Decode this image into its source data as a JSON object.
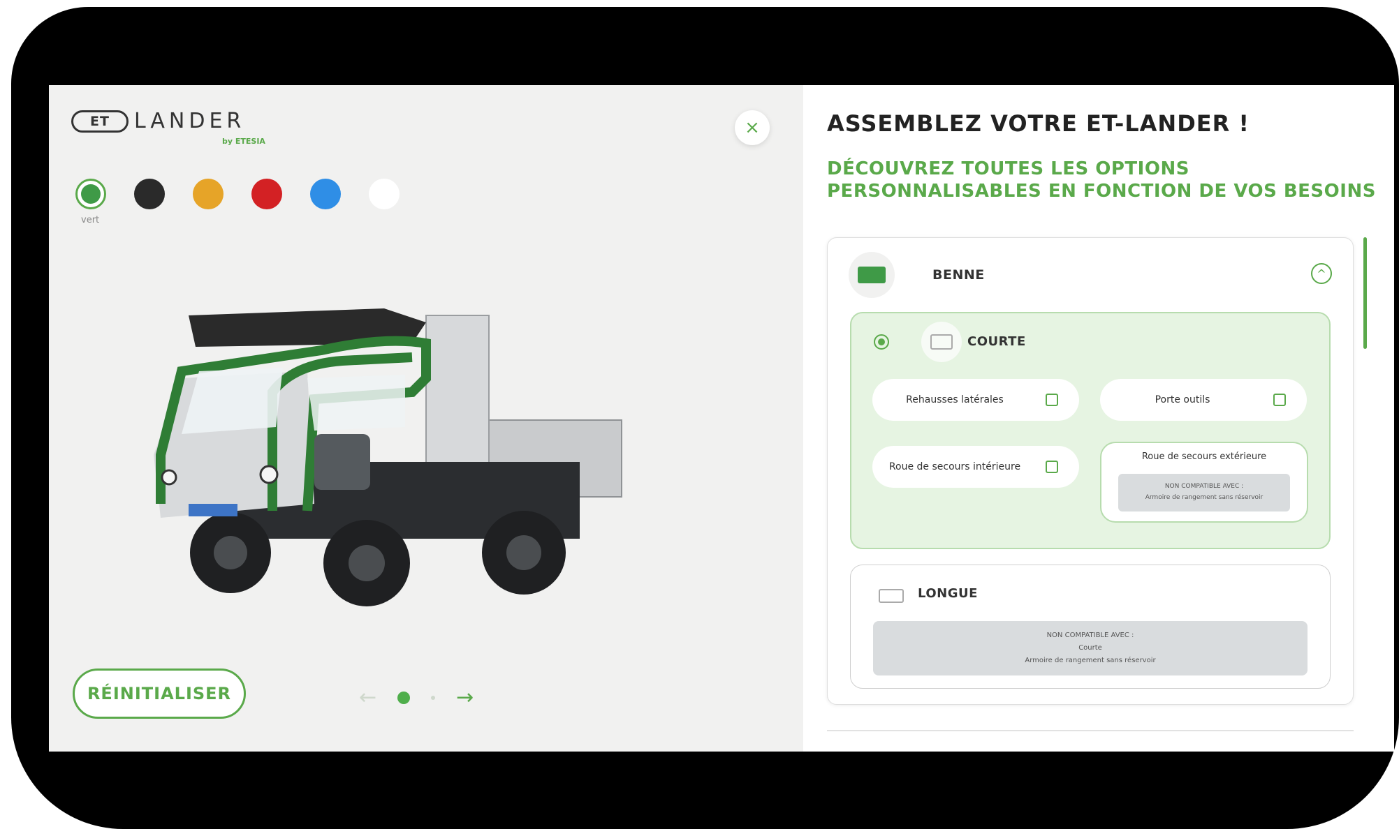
{
  "brand": {
    "badge": "ET",
    "name": "LANDER",
    "by_line": "by ETESIA"
  },
  "colors": {
    "selected_label": "vert",
    "swatches": [
      {
        "name": "vert",
        "hex": "#3f9a47"
      },
      {
        "name": "noir",
        "hex": "#2a2a2a"
      },
      {
        "name": "jaune",
        "hex": "#e6a428"
      },
      {
        "name": "rouge",
        "hex": "#d32124"
      },
      {
        "name": "bleu",
        "hex": "#2f8ee6"
      },
      {
        "name": "blanc",
        "hex": "#ffffff"
      }
    ],
    "accent": "#5aa94a"
  },
  "close_symbol": "×",
  "reset_label": "RÉINITIALISER",
  "pager": {
    "prev": "←",
    "next": "→"
  },
  "configurator": {
    "title": "ASSEMBLEZ VOTRE ET-LANDER !",
    "subtitle": "DÉCOUVREZ TOUTES LES OPTIONS PERSONNALISABLES EN FONCTION DE VOS BESOINS",
    "section": {
      "label": "BENNE",
      "chevron": "^",
      "options": [
        {
          "label": "COURTE",
          "selected": true,
          "sub_options": [
            {
              "label": "Rehausses latérales",
              "checked": false
            },
            {
              "label": "Porte outils",
              "checked": false
            },
            {
              "label": "Roue de secours intérieure",
              "checked": false
            }
          ],
          "incompatible": {
            "label": "Roue de secours extérieure",
            "note_title": "NON COMPATIBLE AVEC :",
            "note_items": "Armoire de rangement sans réservoir"
          }
        },
        {
          "label": "LONGUE",
          "selected": false,
          "note_title": "NON COMPATIBLE AVEC :",
          "note_line1": "Courte",
          "note_line2": "Armoire de rangement sans réservoir"
        }
      ]
    }
  }
}
